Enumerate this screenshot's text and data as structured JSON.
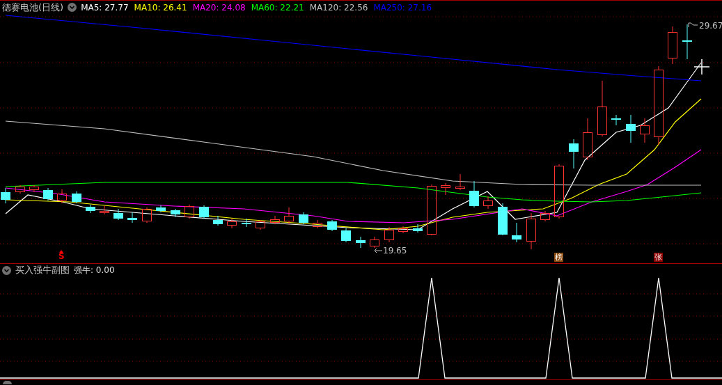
{
  "chart_title": "德赛电池(日线)",
  "ma_legend": [
    {
      "label": "MA5: 27.77",
      "color": "#ffffff"
    },
    {
      "label": "MA10: 26.41",
      "color": "#ffff00"
    },
    {
      "label": "MA20: 24.08",
      "color": "#ff00ff"
    },
    {
      "label": "MA60: 22.21",
      "color": "#00ff00"
    },
    {
      "label": "MA120: 22.56",
      "color": "#c0c0c0"
    },
    {
      "label": "MA250: 27.16",
      "color": "#0000ff"
    }
  ],
  "price_labels": [
    {
      "kind": "high",
      "text": "29.67"
    },
    {
      "kind": "low",
      "text": "19.65"
    }
  ],
  "signals": [
    {
      "kind": "sell",
      "text": "S",
      "color": "#ff0000"
    },
    {
      "kind": "tag",
      "text": "榜",
      "color": "#8b4a10"
    },
    {
      "kind": "tag",
      "text": "张",
      "color": "#8b0000"
    }
  ],
  "sub_chart": {
    "title": "买入强牛副图",
    "reading": "强牛: 0.00"
  }
}
